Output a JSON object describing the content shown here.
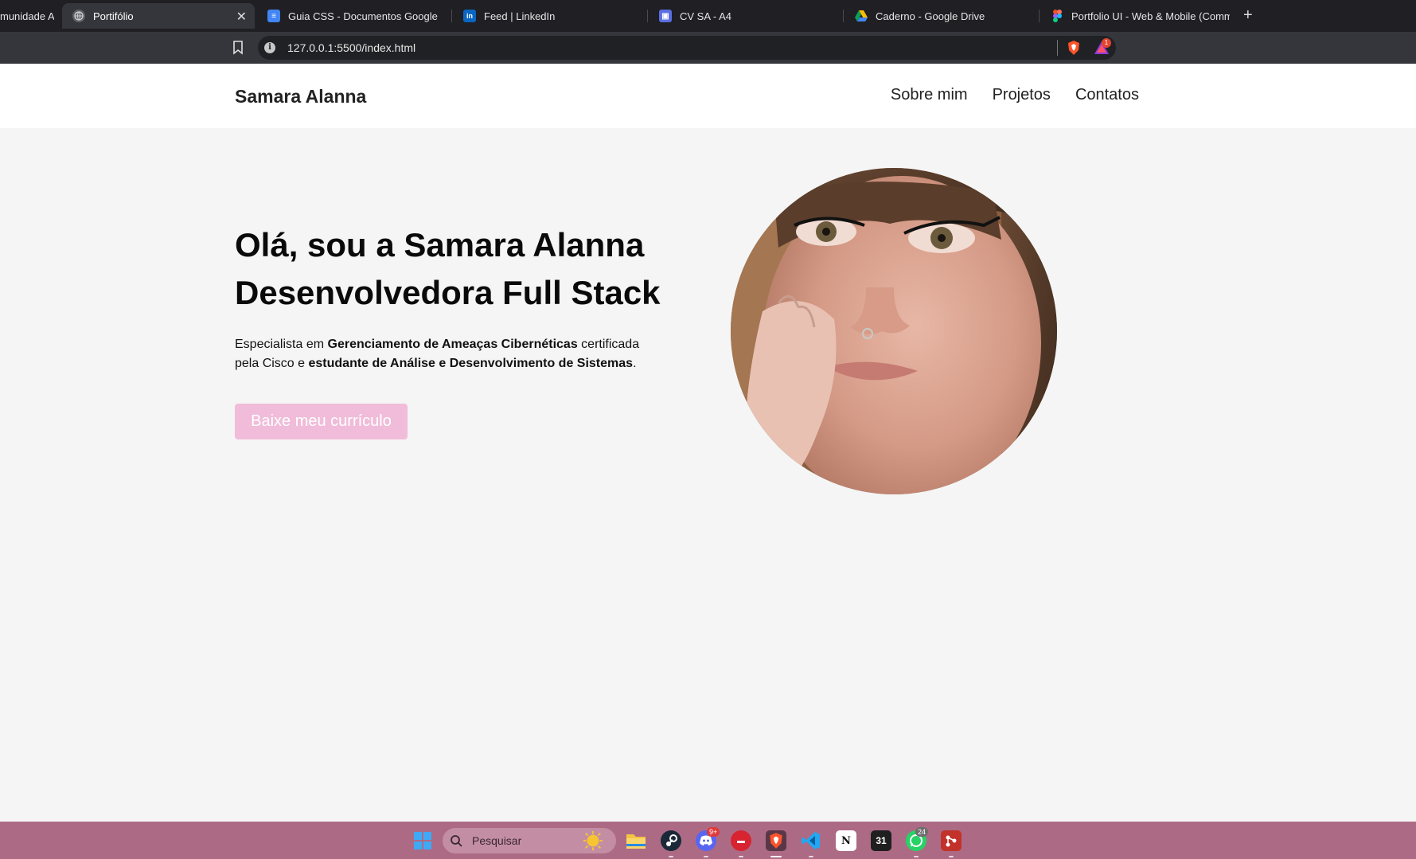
{
  "browser": {
    "tabs": [
      {
        "title": "munidade A",
        "active": false
      },
      {
        "title": "Portifólio",
        "active": true
      },
      {
        "title": "Guia CSS - Documentos Google",
        "active": false
      },
      {
        "title": "Feed | LinkedIn",
        "active": false
      },
      {
        "title": "CV SA - A4",
        "active": false
      },
      {
        "title": "Caderno - Google Drive",
        "active": false
      },
      {
        "title": "Portfolio UI - Web & Mobile (Commu",
        "active": false
      }
    ],
    "url": "127.0.0.1:5500/index.html",
    "notification_count": "1"
  },
  "site": {
    "brand": "Samara Alanna",
    "nav": [
      "Sobre mim",
      "Projetos",
      "Contatos"
    ],
    "hero": {
      "title_line1": "Olá, sou a Samara Alanna",
      "title_line2": "Desenvolvedora Full Stack",
      "text_1": "Especialista em ",
      "text_bold_1": "Gerenciamento de Ameaças Cibernéticas",
      "text_2": " certificada pela Cisco e ",
      "text_bold_2": "estudante de Análise e Desenvolvimento de Sistemas",
      "text_3": ".",
      "button": "Baixe meu currículo"
    }
  },
  "taskbar": {
    "search_placeholder": "Pesquisar",
    "discord_badge": "9+",
    "whatsapp_badge": "24",
    "calendar_day": "31"
  },
  "colors": {
    "accent_pink": "#f0bcd9",
    "taskbar": "#ad6a85"
  }
}
